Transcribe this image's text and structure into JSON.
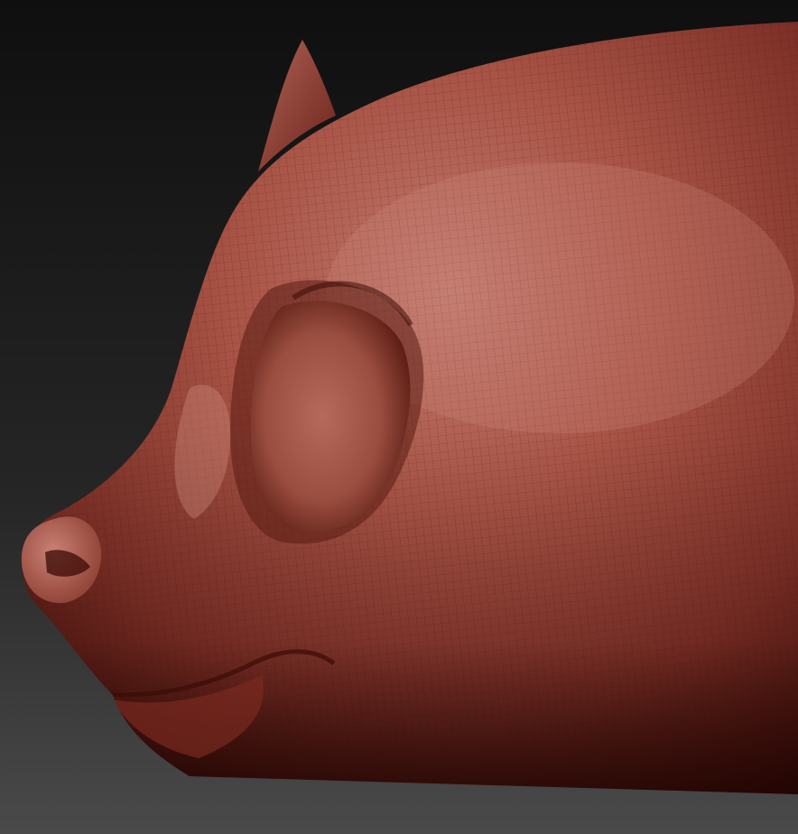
{
  "scene": {
    "background_colors": [
      "#111111",
      "#2a2a2a",
      "#4a4a4a"
    ],
    "surface_colors": {
      "highlight": "#c8847a",
      "base": "#9b4638",
      "mid": "#7d3027",
      "shadow": "#3a0b06",
      "wire": "#5a1a12"
    }
  }
}
